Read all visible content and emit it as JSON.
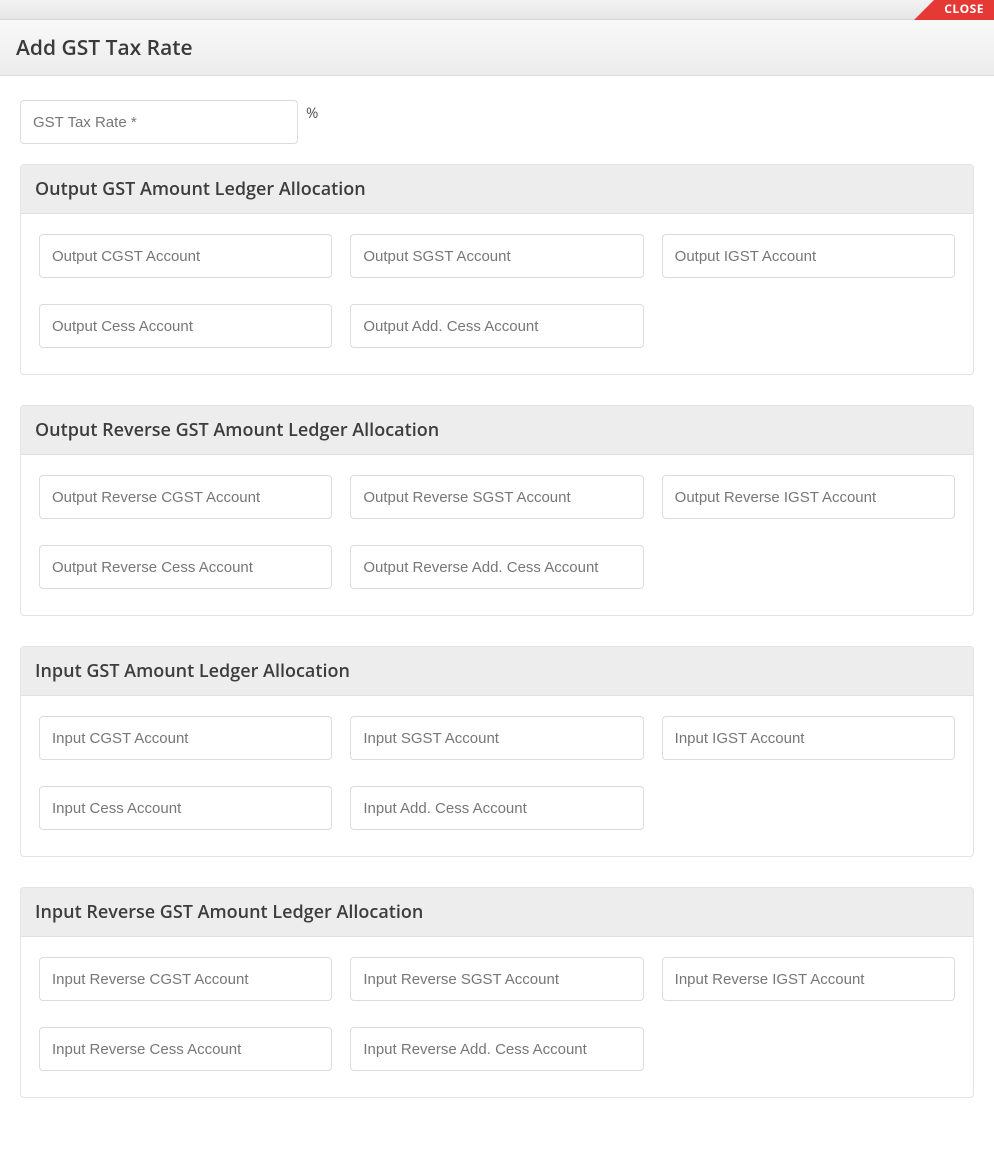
{
  "close_label": "CLOSE",
  "title": "Add GST Tax Rate",
  "rate_placeholder": "GST Tax Rate *",
  "rate_suffix": "%",
  "sections": {
    "output": {
      "title": "Output GST Amount Ledger Allocation",
      "cgst": "Output CGST Account",
      "sgst": "Output SGST Account",
      "igst": "Output IGST Account",
      "cess": "Output Cess Account",
      "addcess": "Output Add. Cess Account"
    },
    "output_rev": {
      "title": "Output Reverse GST Amount Ledger Allocation",
      "cgst": "Output Reverse CGST Account",
      "sgst": "Output Reverse SGST Account",
      "igst": "Output Reverse IGST Account",
      "cess": "Output Reverse Cess Account",
      "addcess": "Output Reverse Add. Cess Account"
    },
    "input": {
      "title": "Input GST Amount Ledger Allocation",
      "cgst": "Input CGST Account",
      "sgst": "Input SGST Account",
      "igst": "Input IGST Account",
      "cess": "Input Cess Account",
      "addcess": "Input Add. Cess Account"
    },
    "input_rev": {
      "title": "Input Reverse GST Amount Ledger Allocation",
      "cgst": "Input Reverse CGST Account",
      "sgst": "Input Reverse SGST Account",
      "igst": "Input Reverse IGST Account",
      "cess": "Input Reverse Cess Account",
      "addcess": "Input Reverse Add. Cess Account"
    }
  }
}
